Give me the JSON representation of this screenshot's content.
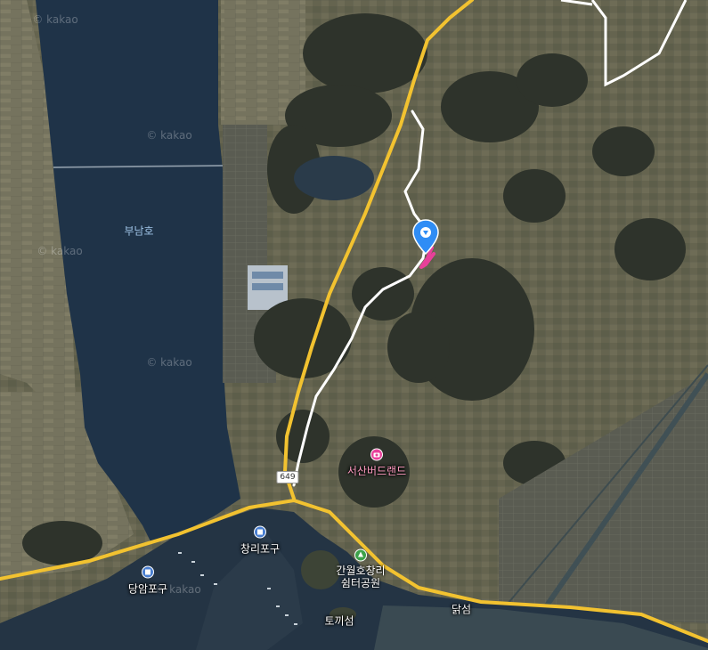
{
  "watermark": "© kakao",
  "labels": {
    "lake": "부남호",
    "birdland": "서산버드랜드",
    "changri_port": "창리포구",
    "dangam_port": "당암포구",
    "park_line1": "간월호창리",
    "park_line2": "쉼터공원",
    "dakseom": "닭섬",
    "tokkiseom": "토끼섬"
  },
  "road_shield": "649",
  "colors": {
    "water": "#1f3348",
    "land": "#4a5040",
    "field": "#6b6a55",
    "road_yellow": "#f2c230",
    "road_white": "#ffffff",
    "route_pink": "#e8409a",
    "marker_blue": "#2f8df5"
  },
  "icons": {
    "marker": "location-pin-icon",
    "camera": "camera-icon",
    "harbor": "harbor-icon",
    "park": "park-icon"
  }
}
